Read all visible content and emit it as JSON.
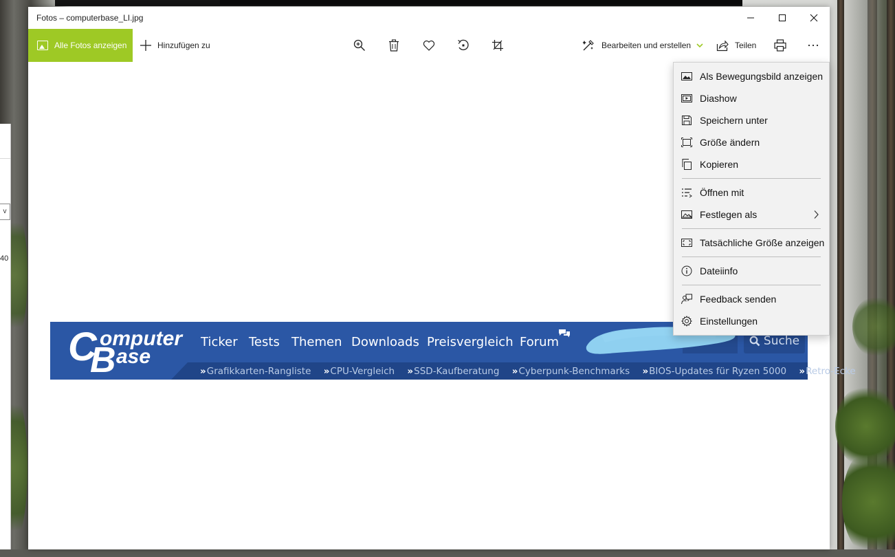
{
  "window": {
    "title": "Fotos – computerbase_LI.jpg",
    "controls": [
      "minimize",
      "maximize",
      "close"
    ]
  },
  "toolbar": {
    "all_photos_label": "Alle Fotos anzeigen",
    "add_to_label": "Hinzufügen zu",
    "edit_create_label": "Bearbeiten und erstellen",
    "share_label": "Teilen",
    "icons": [
      "zoom-icon",
      "delete-icon",
      "heart-icon",
      "rotate-icon",
      "crop-icon",
      "print-icon",
      "more-icon"
    ],
    "accent_color": "#9ec925"
  },
  "background_window": {
    "dropdown_glyph": "v",
    "number_text": "40"
  },
  "image": {
    "banner": {
      "logo_c": "C",
      "logo_omputer": "omputer",
      "logo_b": "B",
      "logo_ase": "ase",
      "nav": [
        "Ticker",
        "Tests",
        "Themen",
        "Downloads",
        "Preisvergleich",
        "Forum"
      ],
      "search_label": "Suche",
      "sublinks": [
        "Grafikkarten-Rangliste",
        "CPU-Vergleich",
        "SSD-Kaufberatung",
        "Cyberpunk-Benchmarks",
        "BIOS-Updates für Ryzen 5000",
        "Retro-Ecke"
      ],
      "colors": {
        "banner": "#2b57a5",
        "bar": "#204588",
        "link": "#b9cbe6",
        "scribble": "#8fd0f0"
      }
    }
  },
  "menu": {
    "items": [
      {
        "label": "Als Bewegungsbild anzeigen",
        "icon": "image-icon"
      },
      {
        "label": "Diashow",
        "icon": "slideshow-icon"
      },
      {
        "label": "Speichern unter",
        "icon": "save-icon"
      },
      {
        "label": "Größe ändern",
        "icon": "resize-icon"
      },
      {
        "label": "Kopieren",
        "icon": "copy-icon"
      },
      {
        "label": "Öffnen mit",
        "icon": "open-with-icon"
      },
      {
        "label": "Festlegen als",
        "icon": "set-as-icon",
        "submenu": true
      },
      {
        "label": "Tatsächliche Größe anzeigen",
        "icon": "actual-size-icon"
      },
      {
        "label": "Dateiinfo",
        "icon": "info-icon"
      },
      {
        "label": "Feedback senden",
        "icon": "feedback-icon"
      },
      {
        "label": "Einstellungen",
        "icon": "settings-icon"
      }
    ]
  }
}
